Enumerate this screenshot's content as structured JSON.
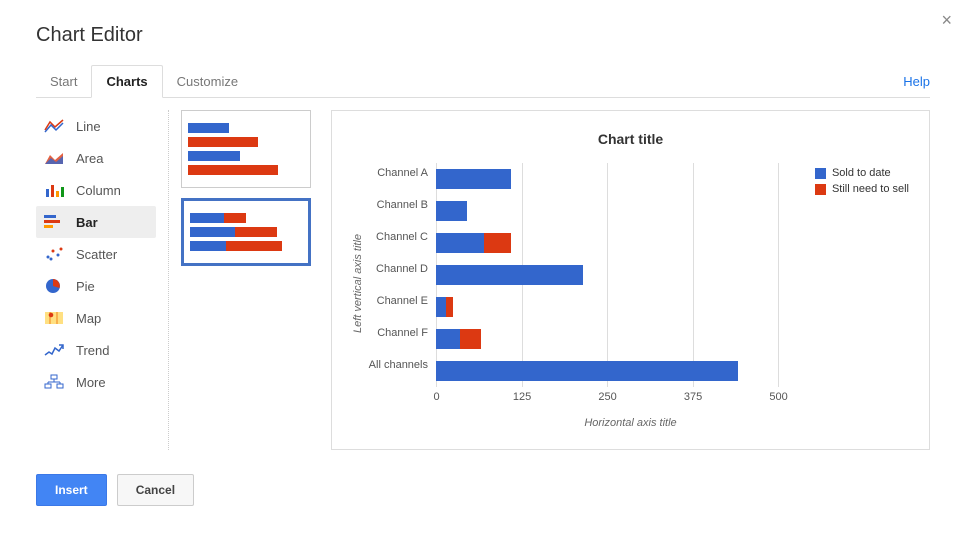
{
  "dialog": {
    "title": "Chart Editor",
    "help": "Help",
    "close": "×"
  },
  "tabs": [
    {
      "id": "start",
      "label": "Start"
    },
    {
      "id": "charts",
      "label": "Charts"
    },
    {
      "id": "customize",
      "label": "Customize"
    }
  ],
  "sidebar": {
    "items": [
      {
        "id": "line",
        "label": "Line"
      },
      {
        "id": "area",
        "label": "Area"
      },
      {
        "id": "column",
        "label": "Column"
      },
      {
        "id": "bar",
        "label": "Bar"
      },
      {
        "id": "scatter",
        "label": "Scatter"
      },
      {
        "id": "pie",
        "label": "Pie"
      },
      {
        "id": "map",
        "label": "Map"
      },
      {
        "id": "trend",
        "label": "Trend"
      },
      {
        "id": "more",
        "label": "More"
      }
    ],
    "active": "bar"
  },
  "colors": {
    "series1": "#3366cc",
    "series2": "#dc3912"
  },
  "buttons": {
    "insert": "Insert",
    "cancel": "Cancel"
  },
  "chart_data": {
    "type": "bar",
    "title": "Chart title",
    "xlabel": "Horizontal axis title",
    "ylabel": "Left vertical axis title",
    "categories": [
      "Channel A",
      "Channel B",
      "Channel C",
      "Channel D",
      "Channel E",
      "Channel F",
      "All channels"
    ],
    "series": [
      {
        "name": "Sold to date",
        "values": [
          110,
          45,
          70,
          215,
          15,
          35,
          440
        ]
      },
      {
        "name": "Still need to sell",
        "values": [
          0,
          0,
          40,
          0,
          10,
          30,
          0
        ]
      }
    ],
    "xticks": [
      0,
      125,
      250,
      375,
      500
    ],
    "xlim": [
      0,
      500
    ]
  }
}
